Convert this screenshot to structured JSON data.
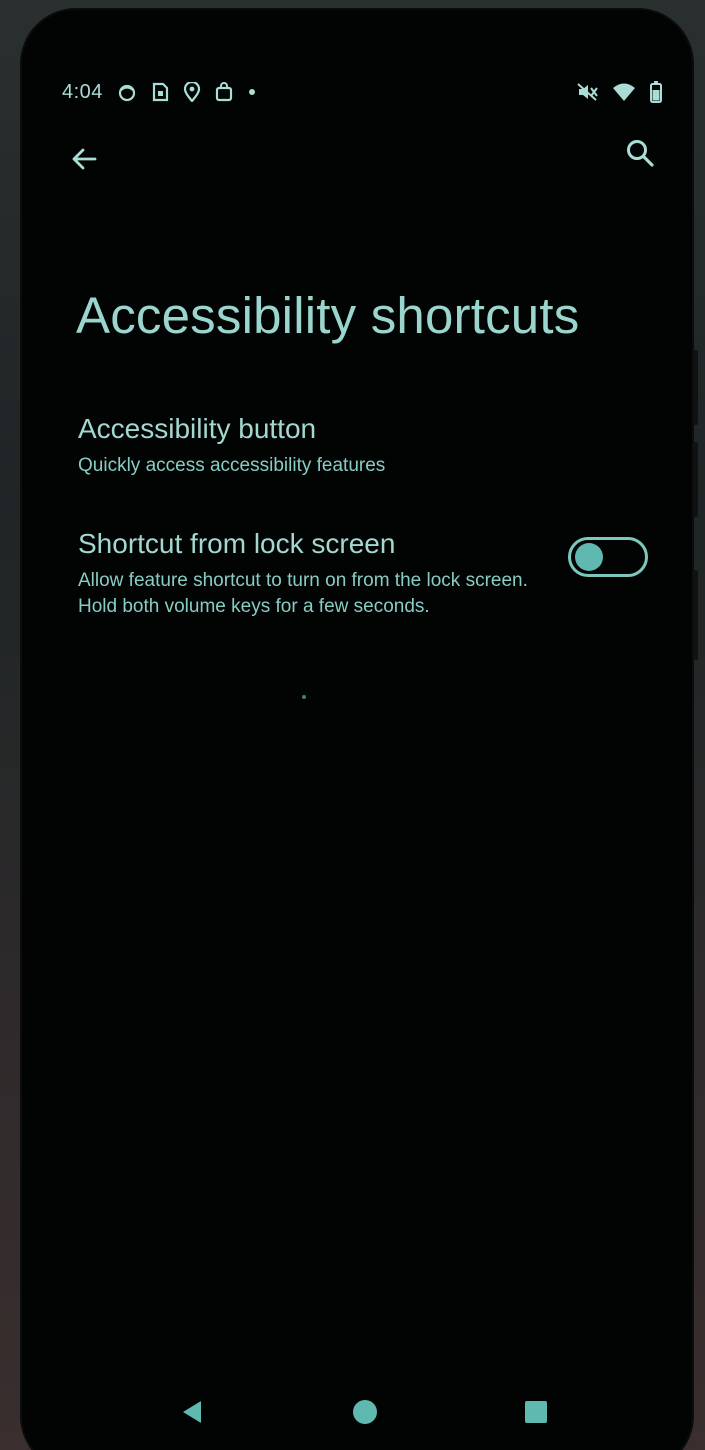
{
  "status_bar": {
    "time": "4:04",
    "left_icons": [
      "app-notification-icon",
      "sim-card-icon",
      "location-pin-icon",
      "shopping-bag-icon",
      "more-notifications-dot-icon"
    ],
    "right_icons": [
      "mute-icon",
      "wifi-icon",
      "battery-icon"
    ]
  },
  "app_bar": {
    "back_icon": "arrow-back-icon",
    "search_icon": "search-icon"
  },
  "page": {
    "title": "Accessibility shortcuts"
  },
  "preferences": [
    {
      "title": "Accessibility button",
      "summary": "Quickly access accessibility features"
    },
    {
      "title": "Shortcut from lock screen",
      "summary": "Allow feature shortcut to turn on from the lock screen. Hold both volume keys for a few seconds.",
      "toggle_on": false
    }
  ],
  "nav_bar": {
    "icons": [
      "nav-back-icon",
      "nav-home-icon",
      "nav-recents-icon"
    ]
  },
  "colors": {
    "accent": "#8fd1c9",
    "screen_background": "#020303",
    "toggle_thumb": "#5fb9b0"
  }
}
